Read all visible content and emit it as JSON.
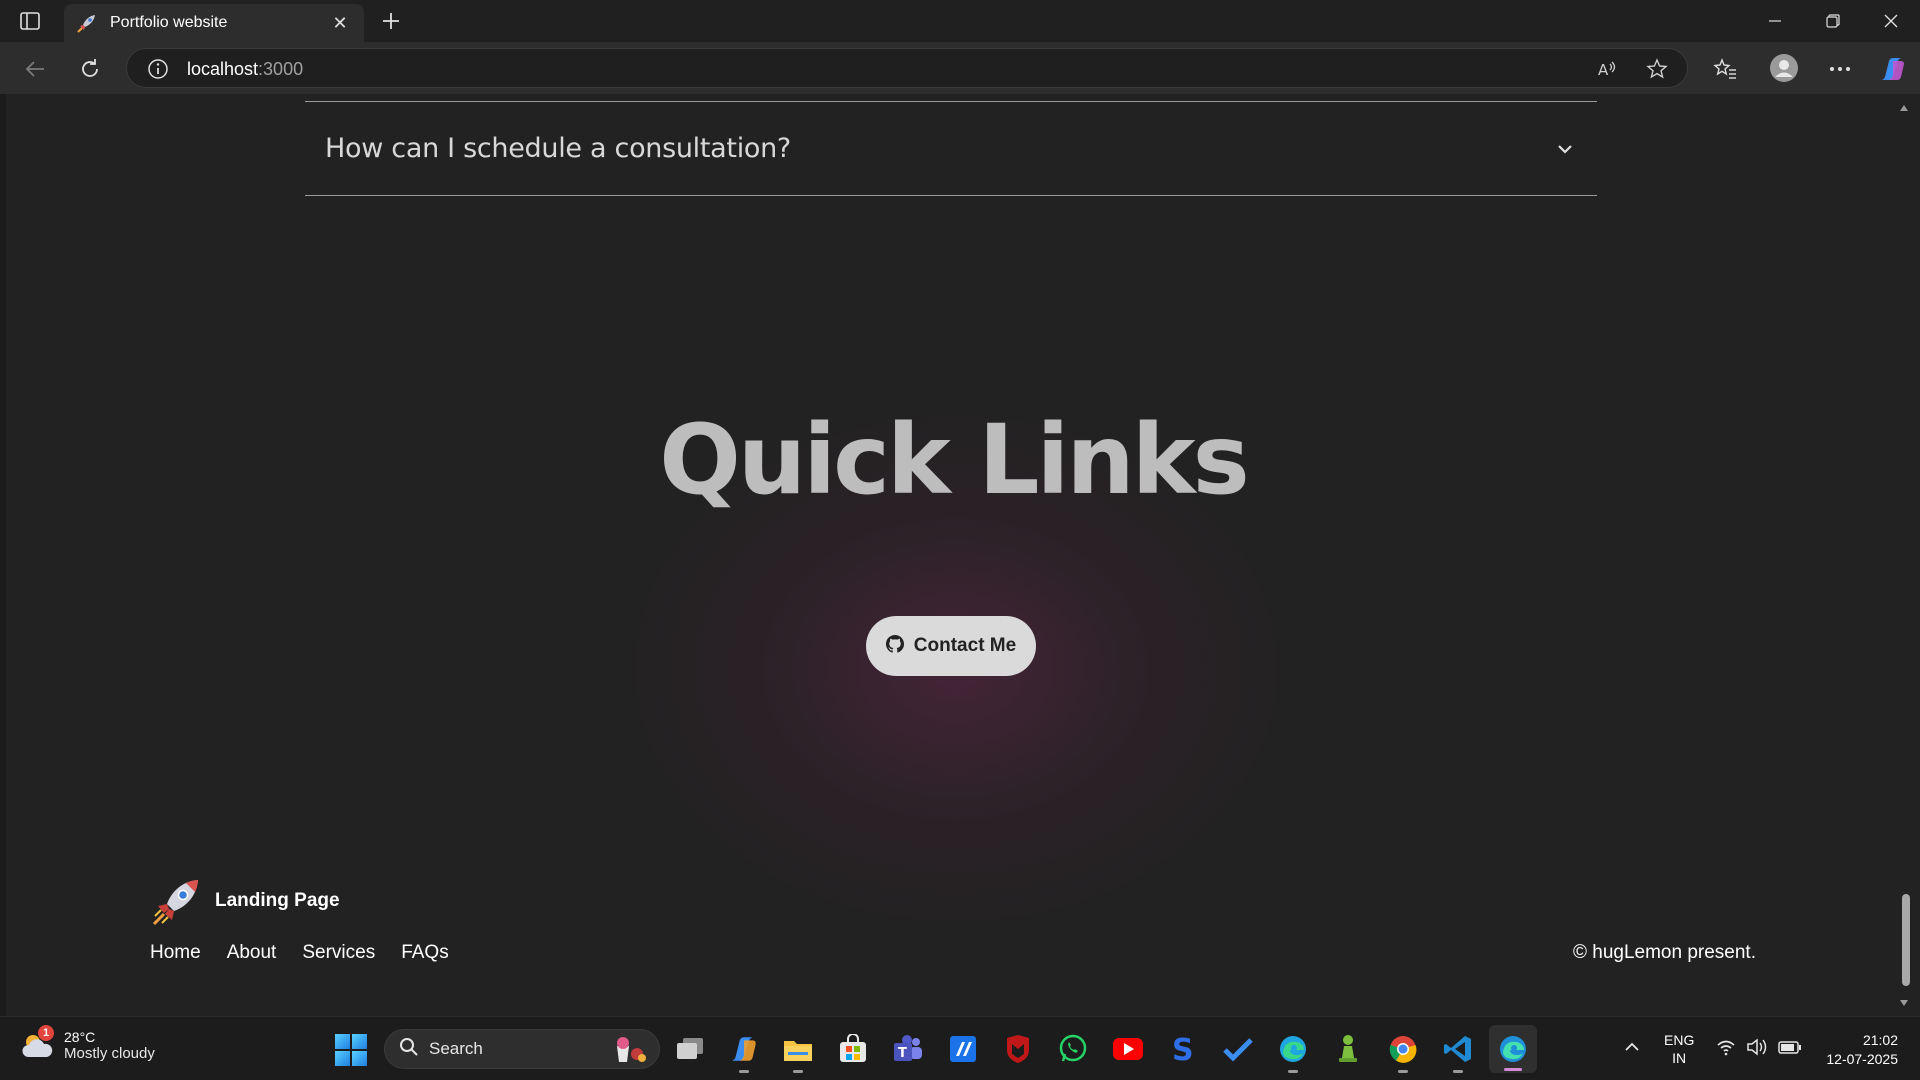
{
  "browser": {
    "tab_title": "Portfolio website",
    "url_host": "localhost",
    "url_port": ":3000",
    "tab_close_symbol": "✕",
    "new_tab_symbol": "+"
  },
  "page": {
    "faq_question": "How can I schedule a consultation?",
    "section_title": "Quick Links",
    "contact_button": "Contact Me",
    "footer": {
      "brand": "Landing Page",
      "links": [
        "Home",
        "About",
        "Services",
        "FAQs"
      ],
      "copyright": "© hugLemon present."
    },
    "accent_color": "#dadada",
    "glow_color": "#6e2850"
  },
  "taskbar": {
    "weather_temp": "28°C",
    "weather_desc": "Mostly cloudy",
    "weather_badge": "1",
    "search_label": "Search",
    "lang_primary": "ENG",
    "lang_secondary": "IN",
    "time": "21:02",
    "date": "12-07-2025",
    "apps": [
      "task-view-icon",
      "copilot-icon",
      "file-explorer-icon",
      "microsoft-store-icon",
      "teams-icon",
      "editor-icon",
      "mcafee-icon",
      "whatsapp-icon",
      "youtube-icon",
      "skype-icon",
      "todo-icon",
      "edge-icon",
      "chess-icon",
      "chrome-icon",
      "vscode-icon",
      "edge-dev-icon"
    ]
  }
}
